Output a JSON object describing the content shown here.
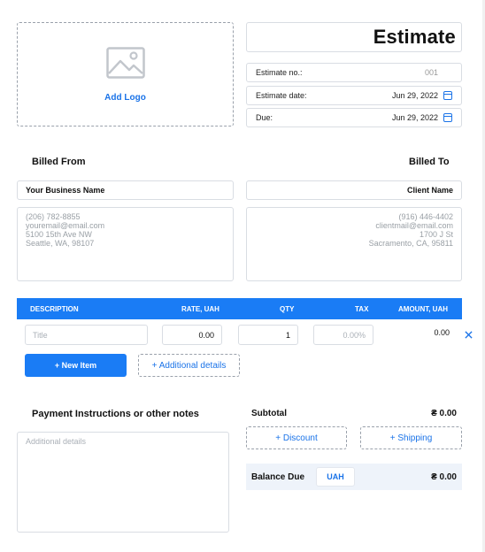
{
  "logo": {
    "label": "Add Logo",
    "icon": "image-placeholder-icon"
  },
  "document": {
    "title": "Estimate"
  },
  "meta": {
    "number_label": "Estimate no.:",
    "number_value": "001",
    "date_label": "Estimate date:",
    "date_value": "Jun 29, 2022",
    "due_label": "Due:",
    "due_value": "Jun 29, 2022"
  },
  "billed_from": {
    "heading": "Billed From",
    "name": "Your Business Name",
    "address_lines": [
      "(206) 782-8855",
      "youremail@email.com",
      "5100 15th Ave NW",
      "Seattle, WA, 98107"
    ]
  },
  "billed_to": {
    "heading": "Billed To",
    "name": "Client Name",
    "address_lines": [
      "(916) 446-4402",
      "clientmail@email.com",
      "1700 J St",
      "Sacramento, CA, 95811"
    ]
  },
  "items_table": {
    "columns": [
      "DESCRIPTION",
      "RATE, UAH",
      "QTY",
      "TAX",
      "AMOUNT, UAH"
    ],
    "row": {
      "title_placeholder": "Title",
      "rate": "0.00",
      "qty": "1",
      "tax_placeholder": "0.00%",
      "amount": "0.00"
    }
  },
  "buttons": {
    "new_item": "+ New Item",
    "additional_details": "+ Additional details",
    "discount": "+ Discount",
    "shipping": "+ Shipping"
  },
  "notes": {
    "heading": "Payment Instructions or other notes",
    "placeholder": "Additional details"
  },
  "totals": {
    "subtotal_label": "Subtotal",
    "subtotal_value": "₴ 0.00",
    "balance_label": "Balance Due",
    "currency": "UAH",
    "balance_value": "₴ 0.00"
  },
  "colors": {
    "accent": "#1a7cf5",
    "link": "#1a73e8",
    "balance_bg": "#eef3fa"
  }
}
